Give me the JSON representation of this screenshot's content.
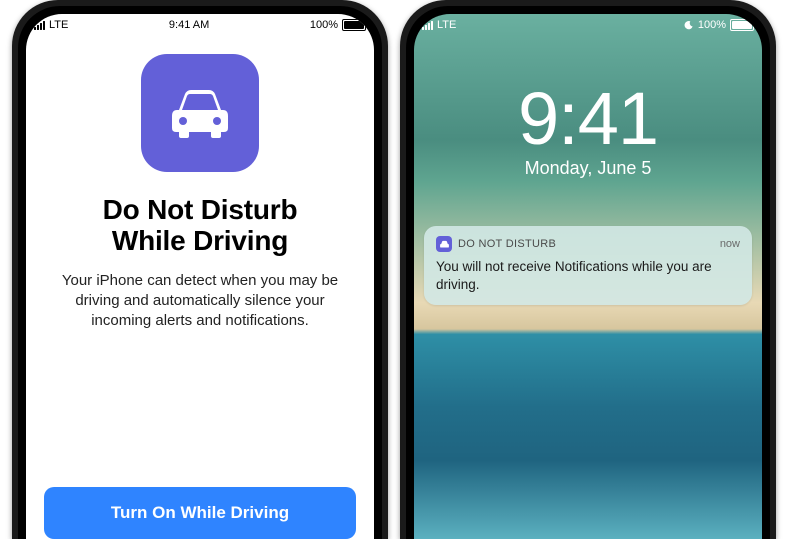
{
  "phone_left": {
    "status": {
      "carrier": "LTE",
      "time": "9:41 AM",
      "battery": "100%"
    },
    "icon_name": "car-icon",
    "heading": "Do Not Disturb\nWhile Driving",
    "body": "Your iPhone can detect when you may be driving and automatically silence your incoming alerts and notifications.",
    "cta_label": "Turn On While Driving",
    "accent_color": "#6360d8",
    "cta_color": "#2f84ff"
  },
  "phone_right": {
    "status": {
      "carrier": "LTE",
      "battery": "100%"
    },
    "clock": "9:41",
    "date": "Monday, June 5",
    "notification": {
      "app_name": "DO NOT DISTURB",
      "timestamp": "now",
      "message": "You will not receive Notifications while you are driving."
    }
  }
}
